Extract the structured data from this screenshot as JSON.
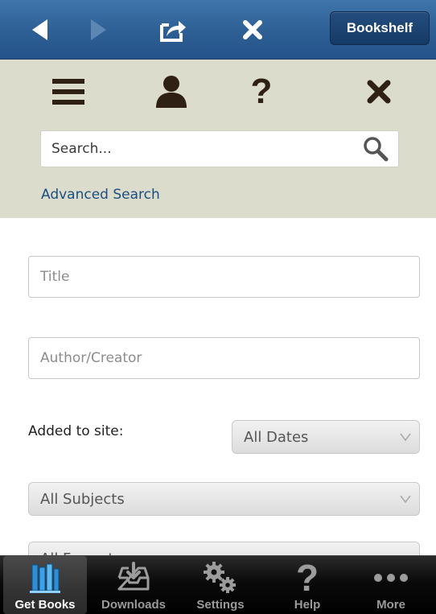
{
  "navbar": {
    "back_icon": "back-arrow-icon",
    "forward_icon": "forward-arrow-icon",
    "share_icon": "share-icon",
    "close_icon": "close-icon",
    "bookshelf_label": "Bookshelf"
  },
  "toolbar": {
    "menu_icon": "menu-icon",
    "account_icon": "user-icon",
    "help_label": "?",
    "close_icon": "close-icon"
  },
  "search": {
    "placeholder": "Search...",
    "value": "",
    "icon": "search-icon",
    "advanced_label": "Advanced Search"
  },
  "form": {
    "title_placeholder": "Title",
    "author_placeholder": "Author/Creator",
    "added_label": "Added to site:",
    "dates_selected": "All Dates",
    "subjects_selected": "All Subjects",
    "formats_selected": "All Formats"
  },
  "tabbar": {
    "tabs": [
      {
        "label": "Get Books",
        "icon": "books-icon",
        "active": true
      },
      {
        "label": "Downloads",
        "icon": "download-tray-icon",
        "active": false
      },
      {
        "label": "Settings",
        "icon": "gears-icon",
        "active": false
      },
      {
        "label": "Help",
        "icon": "help-icon",
        "active": false
      },
      {
        "label": "More",
        "icon": "more-dots-icon",
        "active": false
      }
    ]
  },
  "colors": {
    "navbar_blue": "#2d5f94",
    "panel_beige": "#dcdccc",
    "link_blue": "#1b4e80",
    "icon_brown": "#2e2013"
  }
}
